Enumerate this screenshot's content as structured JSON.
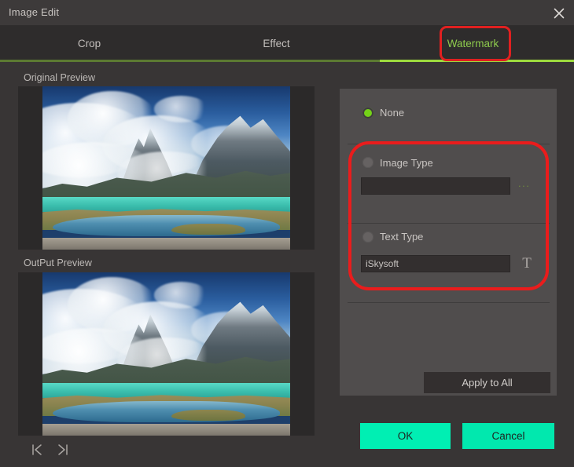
{
  "window": {
    "title": "Image Edit",
    "close_icon": "close-x-icon"
  },
  "tabs": [
    {
      "label": "Crop",
      "active": false
    },
    {
      "label": "Effect",
      "active": false
    },
    {
      "label": "Watermark",
      "active": true
    }
  ],
  "previews": {
    "original_label": "Original Preview",
    "output_label": "OutPut Preview",
    "image_description": "mountain landscape with clouds, turquoise lake and river"
  },
  "nav": {
    "first_icon": "skip-to-first-icon",
    "last_icon": "skip-to-last-icon"
  },
  "panel": {
    "options": [
      {
        "label": "None",
        "selected": true
      },
      {
        "label": "Image Type",
        "selected": false
      },
      {
        "label": "Text Type",
        "selected": false
      }
    ],
    "image_field": {
      "value": "",
      "placeholder": ""
    },
    "browse_button": {
      "label": "...",
      "icon": "ellipsis-icon"
    },
    "text_field": {
      "value": "iSkysoft",
      "placeholder": ""
    },
    "font_button": {
      "label": "T",
      "icon": "text-font-icon"
    },
    "apply_to_all": "Apply to All"
  },
  "footer": {
    "ok": "OK",
    "cancel": "Cancel"
  },
  "annotations": [
    {
      "name": "watermark-tab-highlight",
      "color": "#e02020"
    },
    {
      "name": "watermark-types-highlight",
      "color": "#ea1c1c"
    }
  ],
  "colors": {
    "window_bg": "#383535",
    "titlebar_bg": "#3d3a3a",
    "tabbar_bg": "#2e2c2c",
    "panel_bg": "#504d4d",
    "accent_green": "#9ddb3e",
    "accent_green_dim": "#5c7a32",
    "radio_green": "#74d318",
    "button_teal": "#00efb3",
    "annotation_red": "#ea1c1c",
    "field_bg": "#332f2f"
  }
}
